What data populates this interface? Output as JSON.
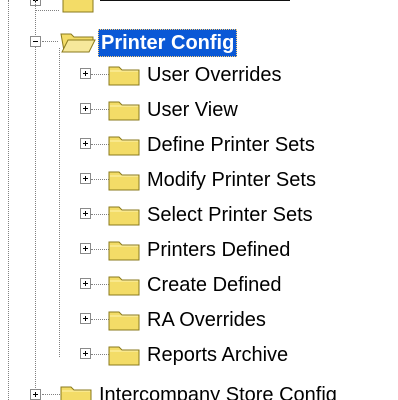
{
  "tree": {
    "selected": {
      "label": "Printer Config",
      "expanded": true
    },
    "children": [
      {
        "label": "User Overrides",
        "expanded": false
      },
      {
        "label": "User View",
        "expanded": false
      },
      {
        "label": "Define Printer Sets",
        "expanded": false
      },
      {
        "label": "Modify Printer Sets",
        "expanded": false
      },
      {
        "label": "Select Printer Sets",
        "expanded": false
      },
      {
        "label": "Printers Defined",
        "expanded": false
      },
      {
        "label": "Create Defined",
        "expanded": false
      },
      {
        "label": "RA Overrides",
        "expanded": false
      },
      {
        "label": "Reports Archive",
        "expanded": false
      }
    ],
    "next_sibling": {
      "label": "Intercompany Store Config",
      "expanded": false
    }
  },
  "icons": {
    "folder_closed": "folder-icon",
    "folder_open": "folder-open-icon",
    "expand": "plus-icon",
    "collapse": "minus-icon"
  },
  "colors": {
    "selection_bg": "#0a58d6",
    "folder_fill": "#f3dc67",
    "folder_stroke": "#8a7a1c",
    "tree_lines": "#808080"
  }
}
